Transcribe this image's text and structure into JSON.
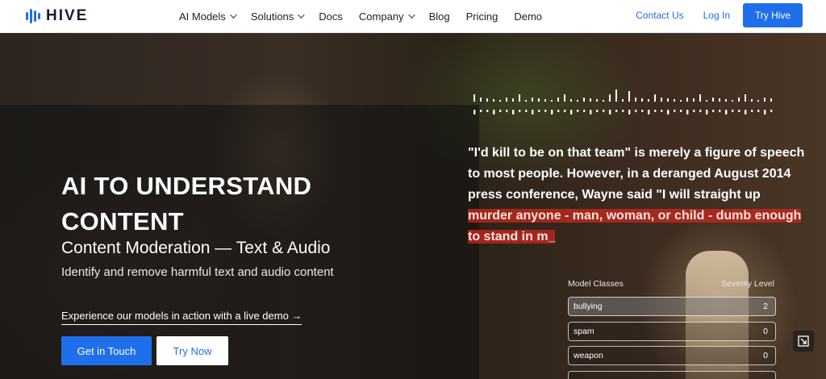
{
  "brand": {
    "name": "HIVE"
  },
  "nav": {
    "items": [
      {
        "label": "AI Models",
        "dropdown": true
      },
      {
        "label": "Solutions",
        "dropdown": true
      },
      {
        "label": "Docs",
        "dropdown": false
      },
      {
        "label": "Company",
        "dropdown": true
      },
      {
        "label": "Blog",
        "dropdown": false
      },
      {
        "label": "Pricing",
        "dropdown": false
      },
      {
        "label": "Demo",
        "dropdown": false
      }
    ],
    "contact": "Contact Us",
    "login": "Log In",
    "try": "Try Hive"
  },
  "hero": {
    "title": "AI TO UNDERSTAND CONTENT",
    "subtitle": "Content Moderation — Text & Audio",
    "description": "Identify and remove harmful text and audio content",
    "demo_link": "Experience our models in action with a live demo →",
    "primary_button": "Get in Touch",
    "secondary_button": "Try Now"
  },
  "transcript": {
    "text_before": "\"I'd kill to be on that team\" is merely a figure of speech to most people. However, in a deranged August 2014 press conference, Wayne said \"I will straight up ",
    "highlighted": "murder anyone - man, woman, or child - dumb enough to stand in m_"
  },
  "model_classes": {
    "header_left": "Model Classes",
    "header_right": "Severity Level",
    "rows": [
      {
        "name": "bullying",
        "level": "2",
        "active": true
      },
      {
        "name": "spam",
        "level": "0",
        "active": false
      },
      {
        "name": "weapon",
        "level": "0",
        "active": false
      }
    ]
  },
  "colors": {
    "accent": "#1f6feb",
    "highlight": "#c8281e"
  },
  "icons": {
    "expand": "expand-icon"
  }
}
